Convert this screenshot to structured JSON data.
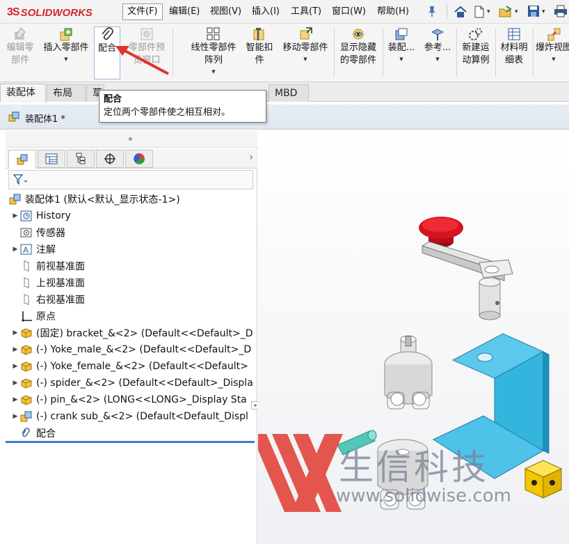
{
  "app": {
    "logo_prefix": "3S",
    "logo_text": "SOLIDWORKS"
  },
  "menus": [
    "文件(F)",
    "编辑(E)",
    "视图(V)",
    "插入(I)",
    "工具(T)",
    "窗口(W)",
    "帮助(H)"
  ],
  "commands": {
    "edit_component": "编辑零\n部件",
    "insert_component": "插入零部件",
    "mate": "配合",
    "component_preview": "零部件预\n览窗口",
    "linear_pattern": "线性零部件阵列",
    "smart_fasteners": "智能扣\n件",
    "move_component": "移动零部件",
    "show_hidden": "显示隐藏\n的零部件",
    "assembly_features": "装配...",
    "reference": "参考...",
    "new_motion_study": "新建运\n动算例",
    "bom": "材料明\n细表",
    "exploded_view": "爆炸视图"
  },
  "tabs": [
    "装配体",
    "布局",
    "草",
    "MBD"
  ],
  "tooltip": {
    "title": "配合",
    "description": "定位两个零部件使之相互相对。"
  },
  "document": {
    "title": "装配体1 *"
  },
  "tree": {
    "root": "装配体1 (默认<默认_显示状态-1>)",
    "history": "History",
    "sensors": "传感器",
    "annotations": "注解",
    "front_plane": "前视基准面",
    "top_plane": "上视基准面",
    "right_plane": "右视基准面",
    "origin": "原点",
    "components": [
      "(固定) bracket_&<2> (Default<<Default>_D",
      "(-) Yoke_male_&<2> (Default<<Default>_D",
      "(-) Yoke_female_&<2> (Default<<Default>",
      "(-) spider_&<2> (Default<<Default>_Displa",
      "(-) pin_&<2> (LONG<<LONG>_Display Sta",
      "(-) crank sub_&<2> (Default<Default_Displ"
    ],
    "mates": "配合"
  },
  "watermark": {
    "cn": "生信科技",
    "url": "www.solidwise.com"
  },
  "colors": {
    "accent": "#3c7ad6",
    "logo_red": "#d2262b",
    "arrow_red": "#e0332b",
    "bracket_blue": "#33b5de",
    "knob_red": "#d4141e"
  }
}
